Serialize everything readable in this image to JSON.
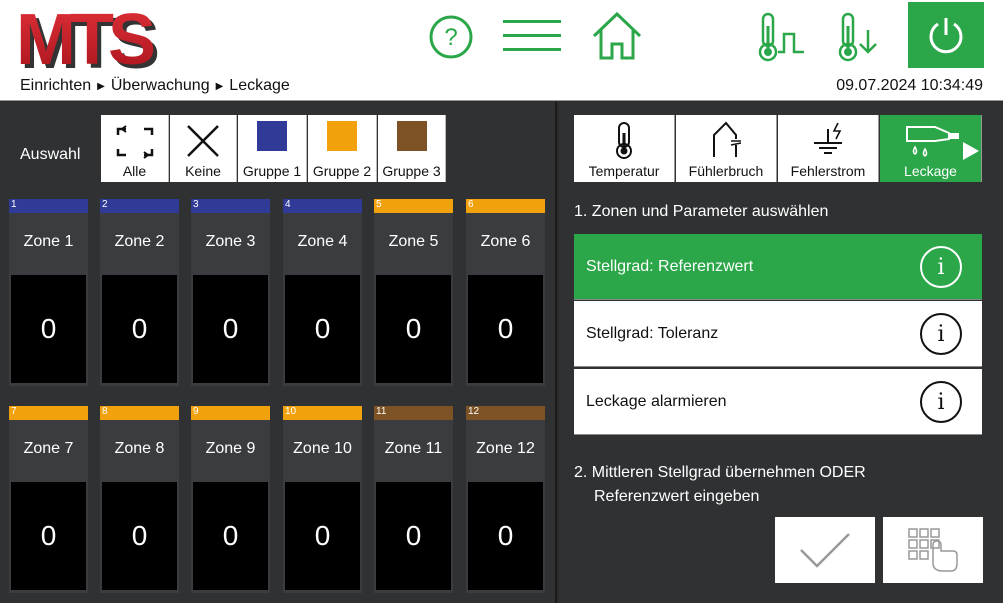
{
  "header": {
    "logo_text": "MTS",
    "breadcrumb": [
      "Einrichten",
      "Überwachung",
      "Leckage"
    ],
    "datetime": "09.07.2024 10:34:49",
    "icons": [
      "help-icon",
      "menu-icon",
      "home-icon",
      "thermometer-pulse-icon",
      "thermometer-down-icon",
      "power-icon"
    ],
    "colors": {
      "accent": "#2ba74a",
      "logo_red": "#c8202a"
    }
  },
  "selection": {
    "label": "Auswahl",
    "buttons": [
      {
        "label": "Alle",
        "icon": "select-all-icon"
      },
      {
        "label": "Keine",
        "icon": "cross-icon"
      },
      {
        "label": "Gruppe 1",
        "color": "#2f3b96"
      },
      {
        "label": "Gruppe 2",
        "color": "#f0a10c"
      },
      {
        "label": "Gruppe 3",
        "color": "#7d5326"
      }
    ]
  },
  "zones": [
    {
      "num": "1",
      "name": "Zone 1",
      "value": "0",
      "color": "#2f3b96"
    },
    {
      "num": "2",
      "name": "Zone 2",
      "value": "0",
      "color": "#2f3b96"
    },
    {
      "num": "3",
      "name": "Zone 3",
      "value": "0",
      "color": "#2f3b96"
    },
    {
      "num": "4",
      "name": "Zone 4",
      "value": "0",
      "color": "#2f3b96"
    },
    {
      "num": "5",
      "name": "Zone 5",
      "value": "0",
      "color": "#f0a10c"
    },
    {
      "num": "6",
      "name": "Zone 6",
      "value": "0",
      "color": "#f0a10c"
    },
    {
      "num": "7",
      "name": "Zone 7",
      "value": "0",
      "color": "#f0a10c"
    },
    {
      "num": "8",
      "name": "Zone 8",
      "value": "0",
      "color": "#f0a10c"
    },
    {
      "num": "9",
      "name": "Zone 9",
      "value": "0",
      "color": "#f0a10c"
    },
    {
      "num": "10",
      "name": "Zone 10",
      "value": "0",
      "color": "#f0a10c"
    },
    {
      "num": "11",
      "name": "Zone 11",
      "value": "0",
      "color": "#7d5326"
    },
    {
      "num": "12",
      "name": "Zone 12",
      "value": "0",
      "color": "#7d5326"
    }
  ],
  "tabs": [
    {
      "label": "Temperatur",
      "icon": "thermometer-icon",
      "active": false
    },
    {
      "label": "Fühlerbruch",
      "icon": "sensor-break-icon",
      "active": false
    },
    {
      "label": "Fehlerstrom",
      "icon": "ground-fault-icon",
      "active": false
    },
    {
      "label": "Leckage",
      "icon": "leakage-icon",
      "active": true
    }
  ],
  "steps": {
    "step1": "1. Zonen und Parameter auswählen",
    "step2_line1": "2. Mittleren Stellgrad übernehmen ODER",
    "step2_line2": "Referenzwert eingeben"
  },
  "params": [
    {
      "label": "Stellgrad: Referenzwert",
      "active": true
    },
    {
      "label": "Stellgrad: Toleranz",
      "active": false
    },
    {
      "label": "Leckage alarmieren",
      "active": false
    }
  ],
  "info_glyph": "i",
  "actions": [
    "confirm-check-icon",
    "keypad-icon"
  ]
}
